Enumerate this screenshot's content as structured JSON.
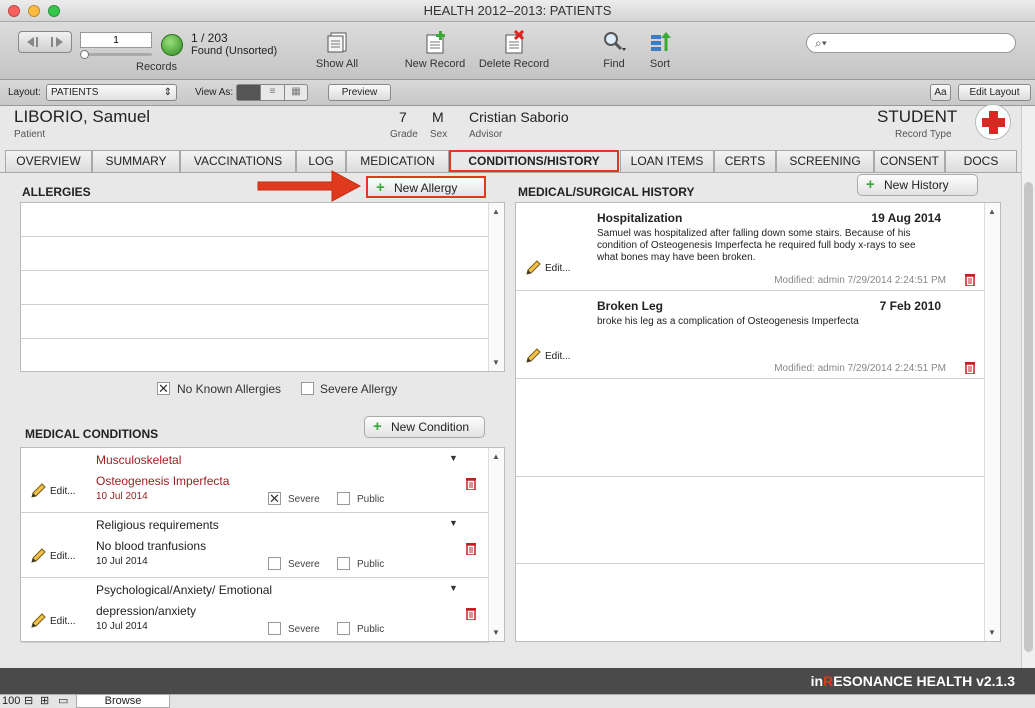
{
  "window": {
    "title": "HEALTH  2012–2013: PATIENTS"
  },
  "toolbar": {
    "record_number": "1",
    "records_label": "Records",
    "count": "1 / 203",
    "found": "Found (Unsorted)",
    "show_all": "Show All",
    "new_record": "New Record",
    "delete_record": "Delete Record",
    "find": "Find",
    "sort": "Sort",
    "search_placeholder": ""
  },
  "layoutbar": {
    "layout_label": "Layout:",
    "layout_value": "PATIENTS",
    "view_as_label": "View As:",
    "preview": "Preview",
    "aa": "Aa",
    "edit_layout": "Edit Layout"
  },
  "patient": {
    "name": "LIBORIO, Samuel",
    "name_label": "Patient",
    "grade": "7",
    "grade_label": "Grade",
    "sex": "M",
    "sex_label": "Sex",
    "advisor": "Cristian Saborio",
    "advisor_label": "Advisor",
    "record_type": "STUDENT",
    "record_type_label": "Record Type"
  },
  "tabs": [
    "OVERVIEW",
    "SUMMARY",
    "VACCINATIONS",
    "LOG",
    "MEDICATION",
    "CONDITIONS/HISTORY",
    "LOAN ITEMS",
    "CERTS",
    "SCREENING",
    "CONSENT",
    "DOCS"
  ],
  "allergies": {
    "title": "ALLERGIES",
    "new_button": "New Allergy",
    "no_known": "No Known Allergies",
    "no_known_checked": true,
    "severe": "Severe Allergy",
    "severe_checked": false
  },
  "conditions": {
    "title": "MEDICAL CONDITIONS",
    "new_button": "New Condition",
    "edit_label": "Edit...",
    "severe_label": "Severe",
    "public_label": "Public",
    "items": [
      {
        "category": "Musculoskeletal",
        "name": "Osteogenesis Imperfecta",
        "date": "10 Jul 2014",
        "severe": true,
        "public": false,
        "highlight": true
      },
      {
        "category": "Religious requirements",
        "name": "No blood tranfusions",
        "date": "10 Jul 2014",
        "severe": false,
        "public": false,
        "highlight": false
      },
      {
        "category": "Psychological/Anxiety/ Emotional",
        "name": "depression/anxiety",
        "date": "10 Jul 2014",
        "severe": false,
        "public": false,
        "highlight": false
      }
    ]
  },
  "history": {
    "title": "MEDICAL/SURGICAL HISTORY",
    "new_button": "New History",
    "edit_label": "Edit...",
    "items": [
      {
        "title": "Hospitalization",
        "date": "19 Aug 2014",
        "text": "Samuel was hospitalized after falling down some stairs. Because of his condition of Osteogenesis Imperfecta he required full body x-rays to see what bones may have been broken.",
        "modified": "Modified: admin  7/29/2014 2:24:51 PM"
      },
      {
        "title": "Broken Leg",
        "date": "7 Feb 2010",
        "text": "broke his leg as a complication of Osteogenesis Imperfecta",
        "modified": "Modified: admin  7/29/2014 2:24:51 PM"
      }
    ]
  },
  "footer": {
    "brand_prefix": "in",
    "brand_r": "R",
    "brand_rest": "ESONANCE HEALTH v2.1.3"
  },
  "statusbar": {
    "zoom": "100",
    "mode": "Browse"
  },
  "colors": {
    "accent": "#e03a1e",
    "condition_red": "#9b1c1c",
    "plus_green": "#38a83a"
  }
}
